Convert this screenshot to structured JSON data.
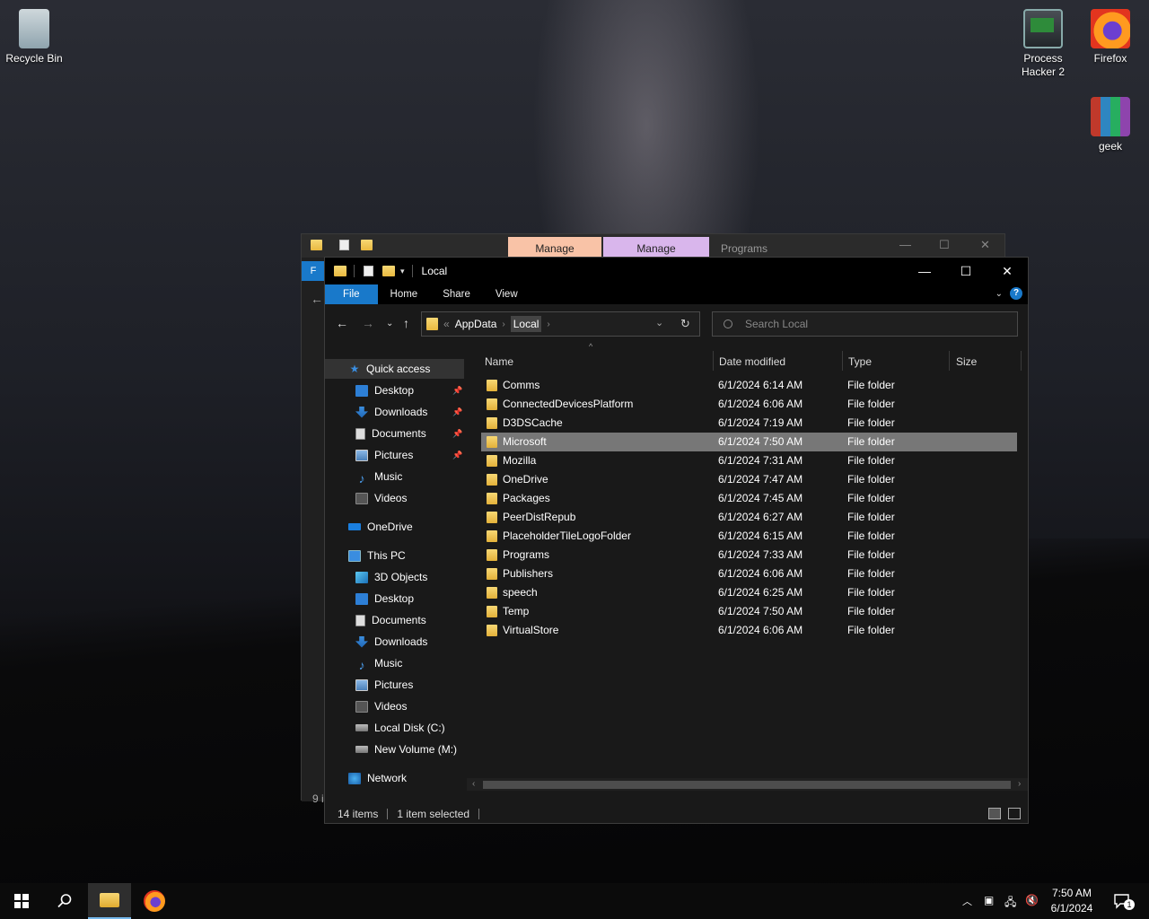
{
  "desktop": {
    "icons": [
      {
        "label": "Recycle Bin"
      },
      {
        "label": "Process Hacker 2"
      },
      {
        "label": "Firefox"
      },
      {
        "label": "geek"
      }
    ]
  },
  "back_window": {
    "tabs": [
      "Manage",
      "Manage",
      "Programs"
    ],
    "tab_colors": [
      "#f9c3a7",
      "#d9b6ec"
    ],
    "status_fragment": "9 i",
    "ribbon_fragment": "F"
  },
  "window": {
    "title": "Local",
    "controls": {
      "minimize": "—",
      "maximize": "☐",
      "close": "✕"
    },
    "ribbon_tabs": [
      "File",
      "Home",
      "Share",
      "View"
    ],
    "address": {
      "overflow": "«",
      "crumbs": [
        "AppData",
        "Local"
      ]
    },
    "search_placeholder": "Search Local",
    "nav_pane": {
      "quick_access": "Quick access",
      "quick_items": [
        "Desktop",
        "Downloads",
        "Documents",
        "Pictures",
        "Music",
        "Videos"
      ],
      "onedrive": "OneDrive",
      "this_pc": "This PC",
      "pc_items": [
        "3D Objects",
        "Desktop",
        "Documents",
        "Downloads",
        "Music",
        "Pictures",
        "Videos",
        "Local Disk (C:)",
        "New Volume (M:)"
      ],
      "network": "Network"
    },
    "columns": [
      "Name",
      "Date modified",
      "Type",
      "Size"
    ],
    "files": [
      {
        "name": "Comms",
        "date": "6/1/2024 6:14 AM",
        "type": "File folder"
      },
      {
        "name": "ConnectedDevicesPlatform",
        "date": "6/1/2024 6:06 AM",
        "type": "File folder"
      },
      {
        "name": "D3DSCache",
        "date": "6/1/2024 7:19 AM",
        "type": "File folder"
      },
      {
        "name": "Microsoft",
        "date": "6/1/2024 7:50 AM",
        "type": "File folder"
      },
      {
        "name": "Mozilla",
        "date": "6/1/2024 7:31 AM",
        "type": "File folder"
      },
      {
        "name": "OneDrive",
        "date": "6/1/2024 7:47 AM",
        "type": "File folder"
      },
      {
        "name": "Packages",
        "date": "6/1/2024 7:45 AM",
        "type": "File folder"
      },
      {
        "name": "PeerDistRepub",
        "date": "6/1/2024 6:27 AM",
        "type": "File folder"
      },
      {
        "name": "PlaceholderTileLogoFolder",
        "date": "6/1/2024 6:15 AM",
        "type": "File folder"
      },
      {
        "name": "Programs",
        "date": "6/1/2024 7:33 AM",
        "type": "File folder"
      },
      {
        "name": "Publishers",
        "date": "6/1/2024 6:06 AM",
        "type": "File folder"
      },
      {
        "name": "speech",
        "date": "6/1/2024 6:25 AM",
        "type": "File folder"
      },
      {
        "name": "Temp",
        "date": "6/1/2024 7:50 AM",
        "type": "File folder"
      },
      {
        "name": "VirtualStore",
        "date": "6/1/2024 6:06 AM",
        "type": "File folder"
      }
    ],
    "selected_file": "Microsoft",
    "status": {
      "items": "14 items",
      "selected": "1 item selected"
    }
  },
  "taskbar": {
    "clock_time": "7:50 AM",
    "clock_date": "6/1/2024",
    "notification_count": "1"
  },
  "colors": {
    "accent": "#1979ca",
    "selection": "#777777"
  }
}
